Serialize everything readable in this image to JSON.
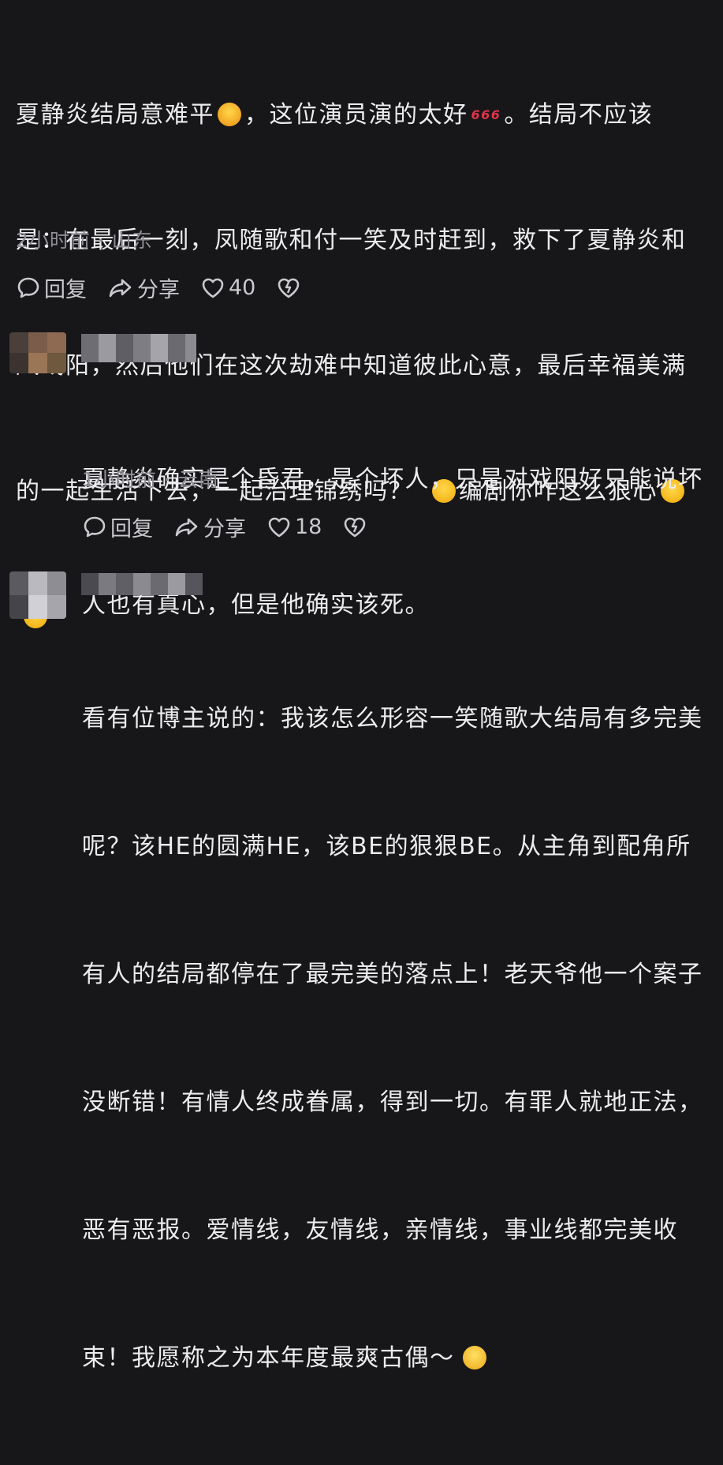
{
  "comments": [
    {
      "text_lines": [
        "夏静炎结局意难平",
        "，这位演员演的太好",
        "。结局不应该",
        "是：在最后一刻，凤随歌和付一笑及时赶到，救下了夏静炎和",
        "凤戏阳，然后他们在这次劫难中知道彼此心意，最后幸福美满",
        "的一起生活下去，一起治理锦绣吗？",
        "编剧你咋这么狠心"
      ],
      "emoji_666": "666",
      "meta": "2小时前 · 山东",
      "reply_label": "回复",
      "share_label": "分享",
      "like_count": "40"
    },
    {
      "text_lines": [
        "夏静炎确实是个昏君，是个坏人，只是对戏阳好只能说坏",
        "人也有真心，但是他确实该死。"
      ],
      "meta": "1小时前 · 云南",
      "reply_label": "回复",
      "share_label": "分享",
      "like_count": "18"
    },
    {
      "text_lines": [
        "看有位博主说的：我该怎么形容一笑随歌大结局有多完美",
        "呢？该HE的圆满HE，该BE的狠狠BE。从主角到配角所",
        "有人的结局都停在了最完美的落点上！老天爷他一个案子",
        "没断错！有情人终成眷属，得到一切。有罪人就地正法，",
        "恶有恶报。爱情线，友情线，亲情线，事业线都完美收",
        "束！我愿称之为本年度最爽古偶～"
      ]
    }
  ],
  "colors": {
    "background": "#17171a",
    "text": "#ececef",
    "meta": "#8e8e94",
    "icon": "#c9c9ce"
  }
}
